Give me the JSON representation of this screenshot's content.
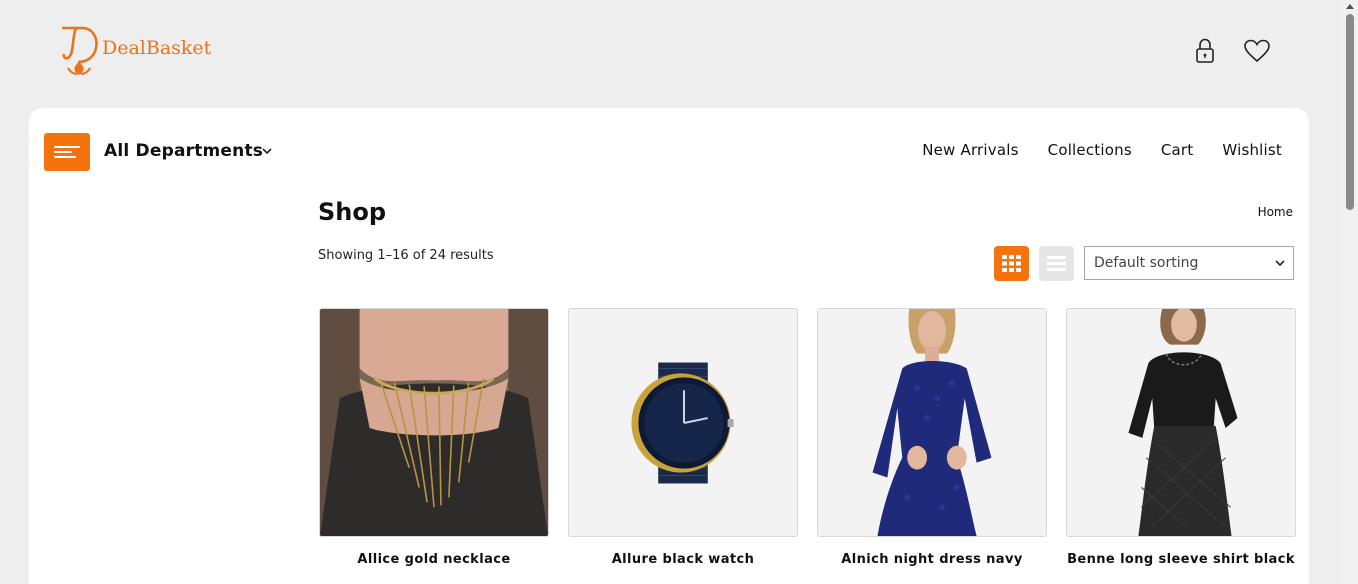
{
  "brand": {
    "name": "DealBasket",
    "accent": "#f5730f"
  },
  "header_icons": {
    "account": "lock-icon",
    "wishlist": "heart-icon"
  },
  "departments": {
    "label": "All Departments"
  },
  "nav": {
    "items": [
      {
        "label": "New Arrivals"
      },
      {
        "label": "Collections"
      },
      {
        "label": "Cart"
      },
      {
        "label": "Wishlist"
      }
    ]
  },
  "page": {
    "title": "Shop",
    "breadcrumb": "Home",
    "result_count": "Showing 1–16 of 24 results"
  },
  "toolbar": {
    "sort_value": "Default sorting",
    "active_view": "grid"
  },
  "products": [
    {
      "name": "Allice gold necklace",
      "image": "gold-necklace"
    },
    {
      "name": "Allure black watch",
      "image": "black-watch"
    },
    {
      "name": "Alnich night dress navy",
      "image": "navy-dress"
    },
    {
      "name": "Benne long sleeve shirt black",
      "image": "black-shirt"
    }
  ]
}
